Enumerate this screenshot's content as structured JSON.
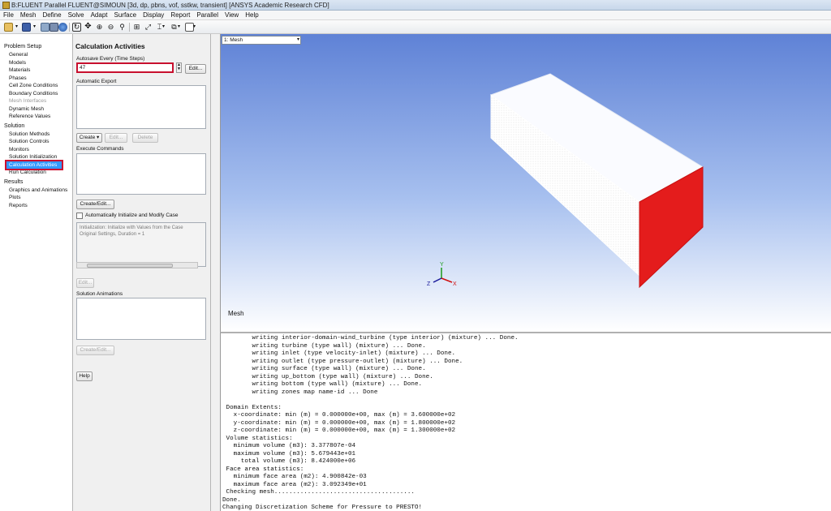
{
  "window": {
    "title": "B:FLUENT Parallel FLUENT@SIMOUN  [3d, dp, pbns, vof, sstkw, transient] [ANSYS Academic Research CFD]"
  },
  "menu": [
    "File",
    "Mesh",
    "Define",
    "Solve",
    "Adapt",
    "Surface",
    "Display",
    "Report",
    "Parallel",
    "View",
    "Help"
  ],
  "tree": {
    "problem_setup": {
      "label": "Problem Setup",
      "items": [
        "General",
        "Models",
        "Materials",
        "Phases",
        "Cell Zone Conditions",
        "Boundary Conditions",
        "Mesh Interfaces",
        "Dynamic Mesh",
        "Reference Values"
      ]
    },
    "solution": {
      "label": "Solution",
      "items": [
        "Solution Methods",
        "Solution Controls",
        "Monitors",
        "Solution Initialization",
        "Calculation Activities",
        "Run Calculation"
      ]
    },
    "results": {
      "label": "Results",
      "items": [
        "Graphics and Animations",
        "Plots",
        "Reports"
      ]
    }
  },
  "panel": {
    "title": "Calculation Activities",
    "autosave_label": "Autosave Every (Time Steps)",
    "autosave_value": "47",
    "edit_label": "Edit...",
    "auto_export_label": "Automatic Export",
    "create_label": "Create",
    "edit_disabled_label": "Edit...",
    "delete_label": "Delete",
    "execute_commands_label": "Execute Commands",
    "create_edit_label": "Create/Edit...",
    "auto_init_label": "Automatically Initialize and Modify Case",
    "init_text_1": "Initialization: Initialize with Values from the Case",
    "init_text_2": "Original Settings, Duration = 1",
    "edit2_label": "Edit...",
    "solution_animations_label": "Solution Animations",
    "create_edit2_label": "Create/Edit...",
    "help_label": "Help"
  },
  "viewport": {
    "selector": "1: Mesh",
    "label": "Mesh",
    "axes": {
      "x": "X",
      "y": "Y",
      "z": "Z"
    }
  },
  "console": {
    "lines": [
      "        writing interior-domain-wind_turbine (type interior) (mixture) ... Done.",
      "        writing turbine (type wall) (mixture) ... Done.",
      "        writing inlet (type velocity-inlet) (mixture) ... Done.",
      "        writing outlet (type pressure-outlet) (mixture) ... Done.",
      "        writing surface (type wall) (mixture) ... Done.",
      "        writing up_bottom (type wall) (mixture) ... Done.",
      "        writing bottom (type wall) (mixture) ... Done.",
      "        writing zones map name-id ... Done",
      "",
      " Domain Extents:",
      "   x-coordinate: min (m) = 0.000000e+00, max (m) = 3.600000e+02",
      "   y-coordinate: min (m) = 0.000000e+00, max (m) = 1.800000e+02",
      "   z-coordinate: min (m) = 0.000000e+00, max (m) = 1.300000e+02",
      " Volume statistics:",
      "   minimum volume (m3): 3.377807e-04",
      "   maximum volume (m3): 5.679443e+01",
      "     total volume (m3): 8.424000e+06",
      " Face area statistics:",
      "   minimum face area (m2): 4.900842e-03",
      "   maximum face area (m2): 3.092349e+01",
      " Checking mesh......................................",
      "Done.",
      "Changing Discretization Scheme for Pressure to PRESTO!"
    ]
  },
  "colors": {
    "highlight_red": "#c8102e",
    "selection_blue": "#3399ff",
    "inlet_face_red": "#e01818"
  }
}
